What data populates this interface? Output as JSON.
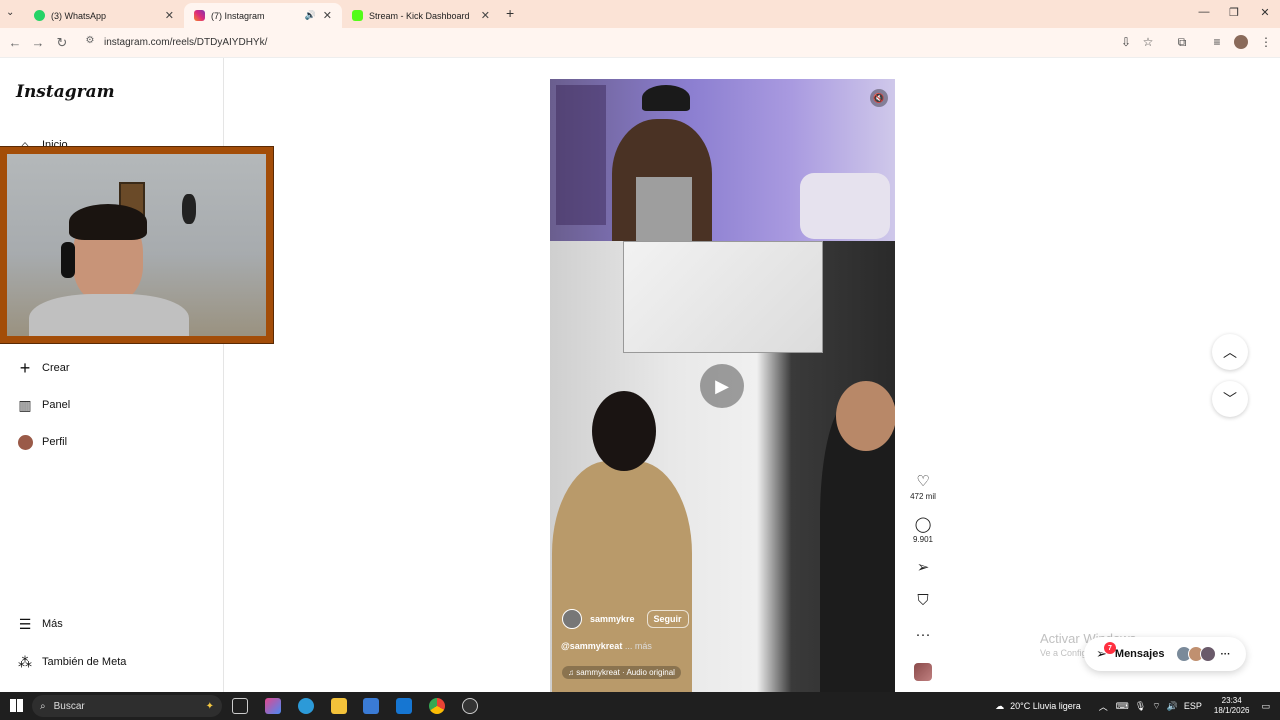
{
  "browser": {
    "tabs": [
      {
        "label": "(3) WhatsApp",
        "color": "#25d366"
      },
      {
        "label": "(7) Instagram",
        "color": "#e1306c"
      },
      {
        "label": "Stream - Kick Dashboard",
        "color": "#53fc18"
      }
    ],
    "url": "instagram.com/reels/DTDyAIYDHYk/"
  },
  "sidebar": {
    "logo": "Instagram",
    "items": {
      "inicio": "Inicio",
      "crear": "Crear",
      "panel": "Panel",
      "perfil": "Perfil",
      "mas": "Más",
      "meta": "También de Meta"
    }
  },
  "reel": {
    "username": "sammykre",
    "follow": "Seguir",
    "caption_user": "@sammykreat",
    "caption_more": "... más",
    "audio": "sammykreat · Audio original",
    "likes": "472 mil",
    "comments": "9.901"
  },
  "watermark": {
    "line1": "Activar Windows",
    "line2": "Ve a Configuración para activar Windows."
  },
  "messages": {
    "label": "Mensajes",
    "badge": "7"
  },
  "taskbar": {
    "search": "Buscar",
    "weather": "20°C  Lluvia ligera",
    "lang": "ESP",
    "time": "23:34",
    "date": "18/1/2026"
  }
}
